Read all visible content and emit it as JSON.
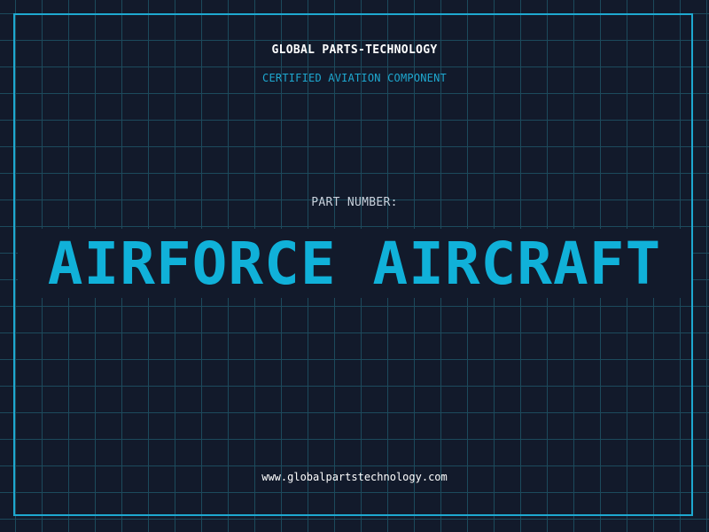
{
  "company_name": "GLOBAL PARTS-TECHNOLOGY",
  "subtitle": "CERTIFIED AVIATION COMPONENT",
  "part_number_label": "PART NUMBER:",
  "part_number_value": "AIRFORCE AIRCRAFT",
  "website": "www.globalpartstechnology.com",
  "colors": {
    "background": "#121a2b",
    "grid": "#1c4a5c",
    "accent": "#1ea8d0",
    "part_number": "#10b1d9",
    "text": "#ffffff"
  }
}
